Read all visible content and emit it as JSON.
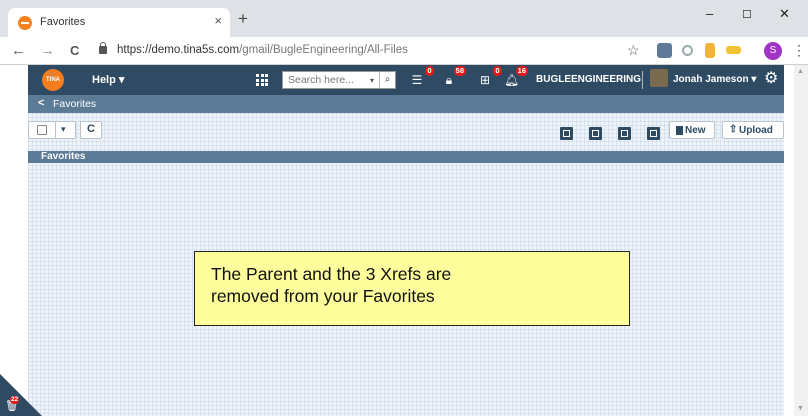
{
  "browser": {
    "tab_title": "Favorites",
    "tab_close": "×",
    "new_tab": "+",
    "url_host": "https://demo.tina5s.com",
    "url_path": "/gmail/BugleEngineering/All-Files",
    "back": "←",
    "forward": "→",
    "reload": "C",
    "bookmark_star": "☆",
    "profile_initial": "S",
    "menu": "⋮",
    "window_controls": {
      "minimize": "–",
      "maximize": "☐",
      "close": "✕"
    }
  },
  "header": {
    "logo_text": "TINA",
    "help_menu": "Help ▾",
    "search_placeholder": "Search here...",
    "search_dropdown": "▾",
    "search_icon": "🔍",
    "badges": {
      "checklist": "0",
      "lock": "58",
      "hierarchy": "0",
      "bell": "16"
    },
    "company": "BUGLEENGINEERING",
    "user_name": "Jonah Jameson ▾",
    "settings_icon": "gear-icon"
  },
  "breadcrumb": {
    "back": "<",
    "label": "Favorites"
  },
  "toolbar": {
    "select_caret": "▾",
    "refresh": "C",
    "new_label": "New",
    "upload_label": "Upload"
  },
  "section_title": "Favorites",
  "callout": {
    "line1": "The Parent and the 3 Xrefs are",
    "line2": "removed from your Favorites"
  },
  "trash_badge": "22",
  "colors": {
    "brand_dark": "#2f4b63",
    "brand_mid": "#5a7a96",
    "logo": "#f47d20",
    "badge": "#e41a1a",
    "callout": "#fefe9c"
  }
}
